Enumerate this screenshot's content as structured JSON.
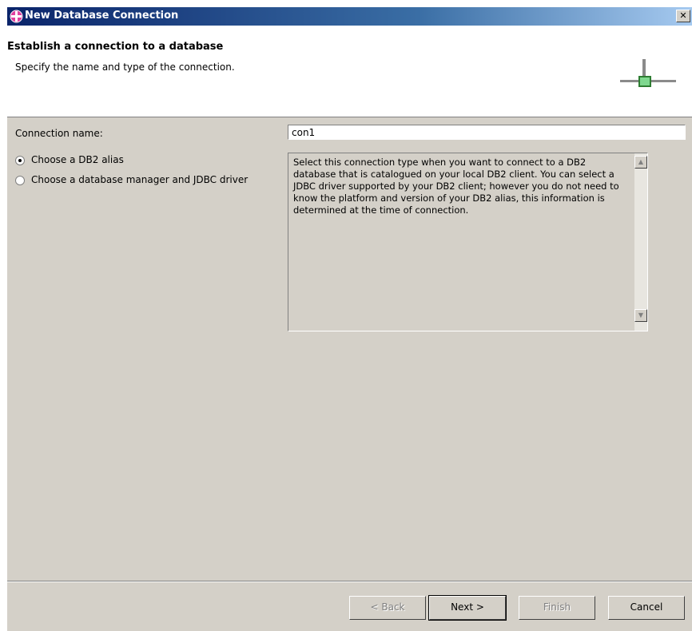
{
  "window": {
    "title": "New Database Connection",
    "close_label": "✕"
  },
  "banner": {
    "title": "Establish a connection to a database",
    "description": "Specify the name and type of the connection."
  },
  "form": {
    "connection_name_label": "Connection name:",
    "connection_name_value": "con1",
    "options": [
      {
        "label": "Choose a DB2 alias",
        "selected": true
      },
      {
        "label": "Choose a database manager and JDBC driver",
        "selected": false
      }
    ],
    "description_text": "Select this connection type when you want to connect to a DB2 database that is catalogued on your local DB2 client. You can select a JDBC driver supported by your DB2 client; however you do not need to know the platform and version of your DB2 alias, this information is determined at the time of connection."
  },
  "buttons": {
    "back": "< Back",
    "next": "Next >",
    "finish": "Finish",
    "cancel": "Cancel"
  }
}
